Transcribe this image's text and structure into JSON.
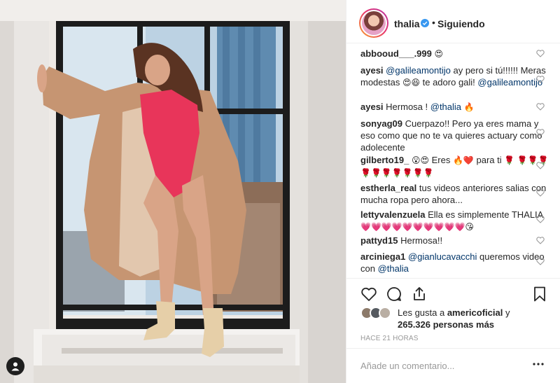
{
  "header": {
    "username": "thalia",
    "separator": "•",
    "follow_state": "Siguiendo",
    "verified_icon": "verified-badge-icon",
    "accent": "#3897f0"
  },
  "comments": [
    {
      "user": "abbooud___.999",
      "text": "",
      "emoji": "😍"
    },
    {
      "user": "ayesi",
      "mention": "@galileamontijo",
      "text": " ay pero si tú!!!!!! Meras modestas ",
      "emoji": "😍😆",
      "text2": " te adoro gali!",
      "mention2": "@galileamontijo"
    },
    {
      "user": "ayesi",
      "text": "Hermosa ! ",
      "mention": "@thalia",
      "emoji": "🔥"
    },
    {
      "user": "sonyag09",
      "text": "Cuerpazo!! Pero ya eres mama y eso como que no te va quieres actuary como adolecente"
    },
    {
      "user": "gilberto19_",
      "emoji": "😮😍",
      "text": "Eres ",
      "emoji2": "🔥❤️",
      "text2": "para ti ",
      "emoji3": "🌹",
      "emoji4": "🌹🌹🌹🌹🌹🌹🌹🌹🌹🌹"
    },
    {
      "user": "estherla_real",
      "text": "tus videos anteriores salias con mucha ropa pero ahora..."
    },
    {
      "user": "lettyvalenzuela",
      "text": "Ella es simplemente THALIA",
      "emoji": "💗💗💗💗💗💗💗💗💗💗😘"
    },
    {
      "user": "pattyd15",
      "text": "Hermosa!!"
    },
    {
      "user": "arciniega1",
      "mention": "@gianlucavacchi",
      "text": " queremos video con ",
      "mention2": "@thalia"
    }
  ],
  "actions": {
    "like_icon": "heart-outline-icon",
    "comment_icon": "comment-bubble-icon",
    "share_icon": "share-icon",
    "save_icon": "bookmark-icon"
  },
  "likes": {
    "prefix": "Les gusta a ",
    "top_user": "americoficial",
    "joiner": " y",
    "count": "265.326 personas más"
  },
  "timestamp": "HACE 21 HORAS",
  "add_comment": {
    "placeholder": "Añade un comentario...",
    "more_icon": "more-options-icon"
  },
  "photo": {
    "alt": "",
    "user_tags_icon": "user-tags-icon"
  },
  "colors": {
    "text": "#262626",
    "mention": "#003569",
    "muted": "#999999",
    "border": "#efefef",
    "swimsuit": "#e8355a"
  }
}
